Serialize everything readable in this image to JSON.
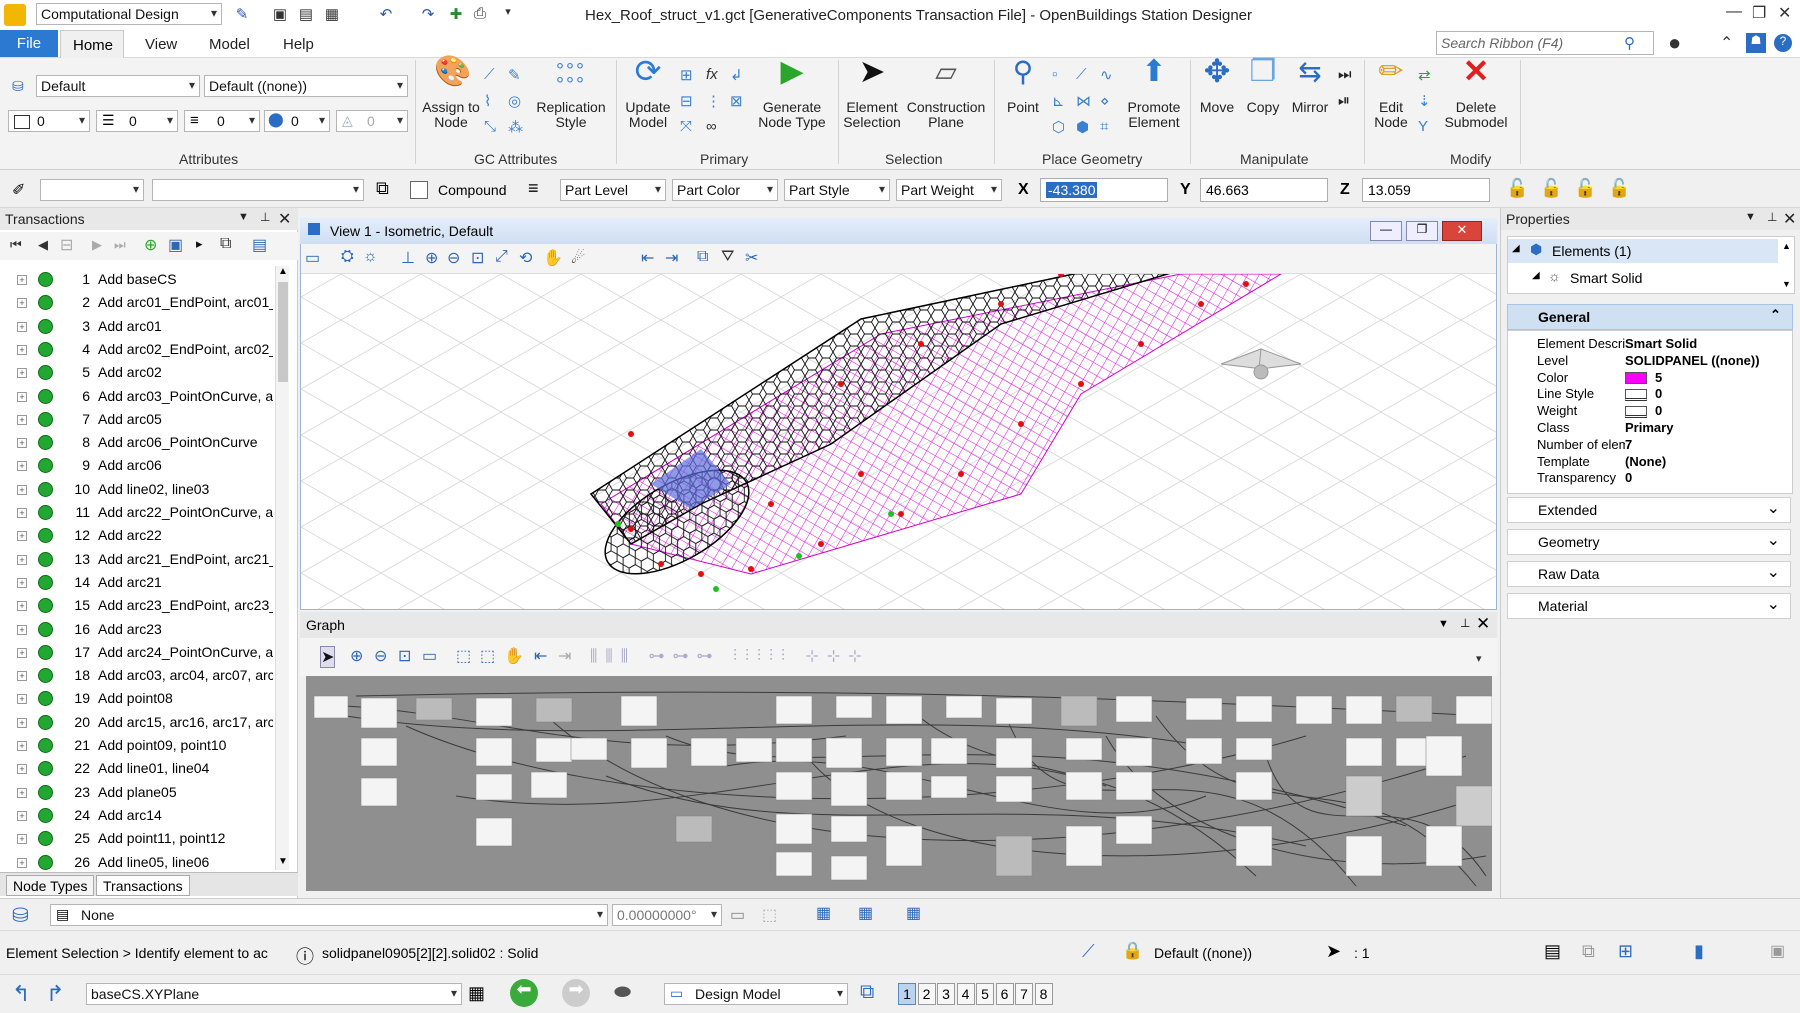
{
  "window": {
    "title": "Hex_Roof_struct_v1.gct [GenerativeComponents Transaction File] - OpenBuildings Station Designer",
    "workflow": "Computational Design"
  },
  "menu": {
    "file": "File",
    "tabs": [
      "Home",
      "View",
      "Model",
      "Help"
    ],
    "search_placeholder": "Search Ribbon (F4)"
  },
  "ribbon": {
    "attributes": {
      "label": "Attributes",
      "level": "Default",
      "template": "Default ((none))",
      "color": "0",
      "line_style": "0",
      "weight": "0",
      "class": "0",
      "transparency": "0"
    },
    "gc_attributes": {
      "label": "GC Attributes",
      "assign_to_node": "Assign to Node",
      "replication_style": "Replication Style"
    },
    "primary": {
      "label": "Primary",
      "update_model": "Update Model",
      "generate_node_type": "Generate Node Type"
    },
    "selection": {
      "label": "Selection",
      "element_selection": "Element Selection",
      "construction_plane": "Construction Plane"
    },
    "place_geometry": {
      "label": "Place Geometry",
      "point": "Point",
      "promote_element": "Promote Element"
    },
    "manipulate": {
      "label": "Manipulate",
      "move": "Move",
      "copy": "Copy",
      "mirror": "Mirror"
    },
    "modify": {
      "label": "Modify",
      "edit_node": "Edit Node",
      "delete_submodel": "Delete Submodel"
    }
  },
  "toolrow": {
    "compound": "Compound",
    "part_level": "Part Level",
    "part_color": "Part Color",
    "part_style": "Part Style",
    "part_weight": "Part Weight",
    "x_label": "X",
    "x_value": "-43.380",
    "y_label": "Y",
    "y_value": "46.663",
    "z_label": "Z",
    "z_value": "13.059"
  },
  "transactions": {
    "title": "Transactions",
    "rows": [
      {
        "n": "1",
        "text": "Add baseCS"
      },
      {
        "n": "2",
        "text": "Add arc01_EndPoint, arc01_E"
      },
      {
        "n": "3",
        "text": "Add arc01"
      },
      {
        "n": "4",
        "text": "Add arc02_EndPoint, arc02_E"
      },
      {
        "n": "5",
        "text": "Add arc02"
      },
      {
        "n": "6",
        "text": "Add arc03_PointOnCurve, ar"
      },
      {
        "n": "7",
        "text": "Add arc05"
      },
      {
        "n": "8",
        "text": "Add arc06_PointOnCurve"
      },
      {
        "n": "9",
        "text": "Add arc06"
      },
      {
        "n": "10",
        "text": "Add line02, line03"
      },
      {
        "n": "11",
        "text": "Add arc22_PointOnCurve, ar"
      },
      {
        "n": "12",
        "text": "Add arc22"
      },
      {
        "n": "13",
        "text": "Add arc21_EndPoint, arc21_E"
      },
      {
        "n": "14",
        "text": "Add arc21"
      },
      {
        "n": "15",
        "text": "Add arc23_EndPoint, arc23_E"
      },
      {
        "n": "16",
        "text": "Add arc23"
      },
      {
        "n": "17",
        "text": "Add arc24_PointOnCurve, ar"
      },
      {
        "n": "18",
        "text": "Add arc03, arc04, arc07, arc0"
      },
      {
        "n": "19",
        "text": "Add point08"
      },
      {
        "n": "20",
        "text": "Add arc15, arc16, arc17, arc1"
      },
      {
        "n": "21",
        "text": "Add point09, point10"
      },
      {
        "n": "22",
        "text": "Add line01, line04"
      },
      {
        "n": "23",
        "text": "Add plane05"
      },
      {
        "n": "24",
        "text": "Add arc14"
      },
      {
        "n": "25",
        "text": "Add point11, point12"
      },
      {
        "n": "26",
        "text": "Add line05, line06"
      }
    ],
    "tab_node_types": "Node Types",
    "tab_transactions": "Transactions"
  },
  "view": {
    "title": "View 1 - Isometric, Default"
  },
  "graph": {
    "title": "Graph"
  },
  "properties": {
    "title": "Properties",
    "elements": "Elements (1)",
    "smart_solid": "Smart Solid",
    "general": "General",
    "rows": [
      {
        "k": "Element Descri",
        "v": "Smart Solid"
      },
      {
        "k": "Level",
        "v": "SOLIDPANEL ((none))"
      },
      {
        "k": "Color",
        "v": "5"
      },
      {
        "k": "Line Style",
        "v": "0"
      },
      {
        "k": "Weight",
        "v": "0"
      },
      {
        "k": "Class",
        "v": "Primary"
      },
      {
        "k": "Number of elem",
        "v": "7"
      },
      {
        "k": "Template",
        "v": "(None)"
      },
      {
        "k": "Transparency",
        "v": "0"
      }
    ],
    "sections": [
      "Extended",
      "Geometry",
      "Raw Data",
      "Material"
    ],
    "color_hex": "#ff00ff"
  },
  "status": {
    "none": "None",
    "angle": "0.00000000°",
    "prompt": "Element Selection > Identify element to ac",
    "element_info": "solidpanel0905[2][2].solid02 : Solid",
    "level": "Default ((none))",
    "count": ": 1",
    "plane": "baseCS.XYPlane",
    "model": "Design Model",
    "views": [
      "1",
      "2",
      "3",
      "4",
      "5",
      "6",
      "7",
      "8"
    ]
  }
}
